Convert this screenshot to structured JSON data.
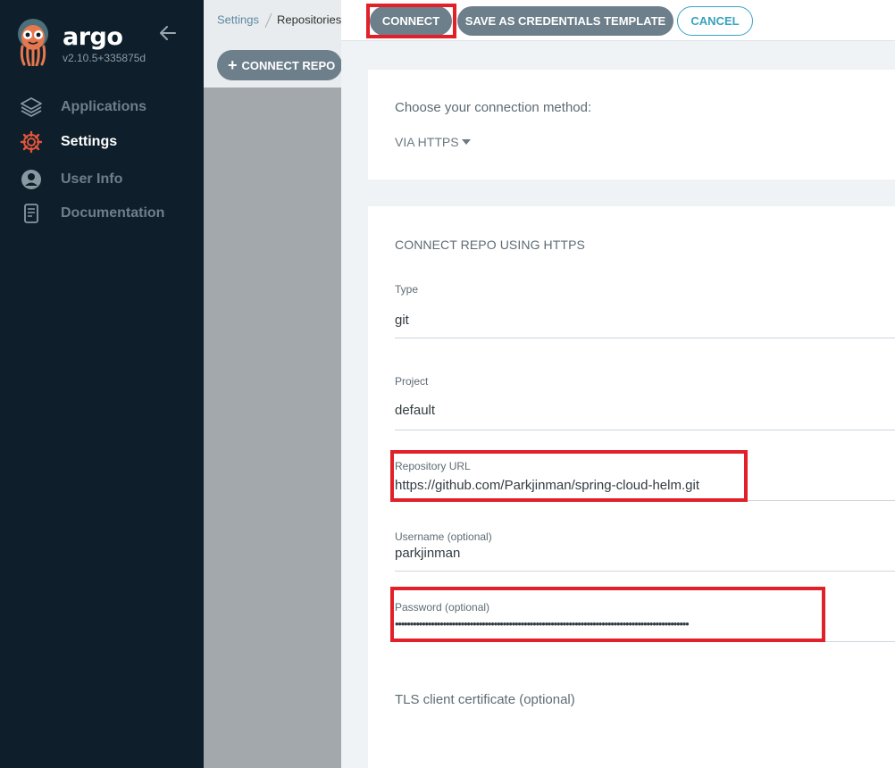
{
  "sidebar": {
    "brand": "argo",
    "version": "v2.10.5+335875d",
    "items": [
      {
        "label": "Applications",
        "icon": "layers-icon"
      },
      {
        "label": "Settings",
        "icon": "gear-icon"
      },
      {
        "label": "User Info",
        "icon": "user-icon"
      },
      {
        "label": "Documentation",
        "icon": "book-icon"
      }
    ]
  },
  "breadcrumb": {
    "parent": "Settings",
    "current": "Repositories"
  },
  "toolbar": {
    "connect_repo_label": "CONNECT REPO"
  },
  "panel": {
    "actions": {
      "connect": "CONNECT",
      "save_template": "SAVE AS CREDENTIALS TEMPLATE",
      "cancel": "CANCEL"
    },
    "method_label": "Choose your connection method:",
    "method_value": "VIA HTTPS",
    "section_title": "CONNECT REPO USING HTTPS",
    "fields": {
      "type": {
        "label": "Type",
        "value": "git"
      },
      "project": {
        "label": "Project",
        "value": "default"
      },
      "repo_url": {
        "label": "Repository URL",
        "value": "https://github.com/Parkjinman/spring-cloud-helm.git"
      },
      "username": {
        "label": "Username (optional)",
        "value": "parkjinman"
      },
      "password": {
        "label": "Password (optional)",
        "value": "••••••••••••••••••••••••••••••••••••••••••••••••••••••••••••••••••••••••••••••••••••••••••••••••••"
      }
    },
    "tls_label": "TLS client certificate (optional)"
  },
  "colors": {
    "sidebar_bg": "#0e1f2b",
    "accent": "#37a3c0",
    "button_gray": "#6d7f8b",
    "highlight_red": "#e1202a"
  }
}
